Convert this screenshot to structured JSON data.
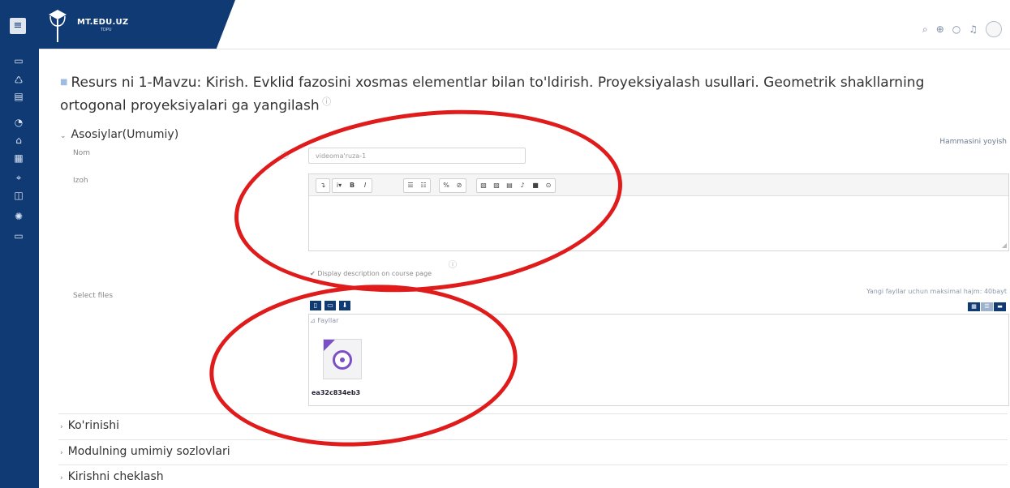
{
  "header": {
    "logo_title": "MT.EDU.UZ",
    "logo_subtitle": "TDPU",
    "brand_color": "#0f3a73"
  },
  "page": {
    "title": "Resurs ni 1-Mavzu: Kirish. Evklid fazosini xosmas elementlar bilan to'ldirish. Proyeksiyalash usullari. Geometrik shakllarning ortogonal proyeksiyalari ga yangilash",
    "expand_all": "Hammasini yoyish"
  },
  "general": {
    "heading": "Asosiylar(Umumiy)",
    "name_label": "Nom",
    "name_value": "videoma'ruza-1",
    "desc_label": "Izoh",
    "display_desc_label": "Display description on course page",
    "select_files_label": "Select files",
    "max_size_text": "Yangi fayllar uchun maksimal hajm: 40bayt",
    "breadcrumb": "Fayllar",
    "file_name": "ea32c834eb3"
  },
  "sections": {
    "appearance": "Ko'rinishi",
    "common_module": "Modulning umimiy sozlovlari",
    "restrict_access": "Kirishni cheklash"
  },
  "annotation_color": "#e01b1b"
}
